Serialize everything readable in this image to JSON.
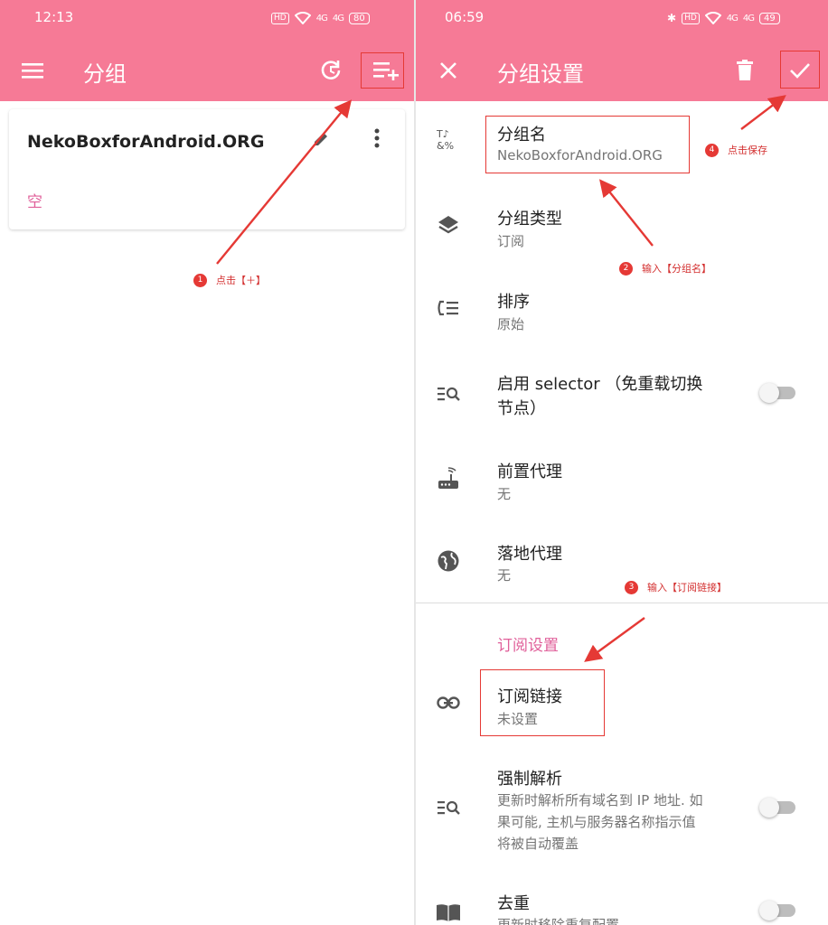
{
  "left": {
    "status": {
      "time": "12:13",
      "hd": "HD",
      "sig1": "4G",
      "sig2": "4G",
      "battery": "80"
    },
    "appbar": {
      "title": "分组",
      "menu_icon": "menu-icon",
      "refresh_icon": "refresh-icon",
      "add_icon": "playlist-add-icon"
    },
    "card": {
      "title": "NekoBoxforAndroid.ORG",
      "empty": "空",
      "edit_icon": "edit-icon",
      "more_icon": "more-vert-icon"
    }
  },
  "right": {
    "status": {
      "time": "06:59",
      "hd": "HD",
      "sig1": "4G",
      "sig2": "4G",
      "battery": "49"
    },
    "appbar": {
      "title": "分组设置",
      "close_icon": "close-icon",
      "delete_icon": "delete-icon",
      "save_icon": "check-icon"
    },
    "prefs": [
      {
        "title": "分组名",
        "summary": "NekoBoxforAndroid.ORG",
        "icon": "text-format-icon"
      },
      {
        "title": "分组类型",
        "summary": "订阅",
        "icon": "layers-icon"
      },
      {
        "title": "排序",
        "summary": "原始",
        "icon": "sort-icon"
      },
      {
        "title": "启用 selector （免重载切换",
        "title2": "节点）",
        "icon": "list-search-icon"
      },
      {
        "title": "前置代理",
        "summary": "无",
        "icon": "router-icon"
      },
      {
        "title": "落地代理",
        "summary": "无",
        "icon": "globe-icon"
      },
      {
        "title": "订阅链接",
        "summary": "未设置",
        "icon": "link-icon"
      },
      {
        "title": "强制解析",
        "summary1": "更新时解析所有域名到 IP 地址. 如",
        "summary2": "果可能, 主机与服务器名称指示值",
        "summary3": "将被自动覆盖",
        "icon": "list-search-icon"
      },
      {
        "title": "去重",
        "summary": "更新时移除重复配置",
        "icon": "book-icon"
      }
    ],
    "section": "订阅设置"
  },
  "annotations": [
    {
      "num": "1",
      "text": "点击【＋】"
    },
    {
      "num": "2",
      "text": "输入【分组名】"
    },
    {
      "num": "3",
      "text": "输入【订阅链接】"
    },
    {
      "num": "4",
      "text": "点击保存"
    }
  ],
  "colors": {
    "appbar": "#f67a96",
    "accent": "#e0609a",
    "annotation": "#e53935"
  }
}
